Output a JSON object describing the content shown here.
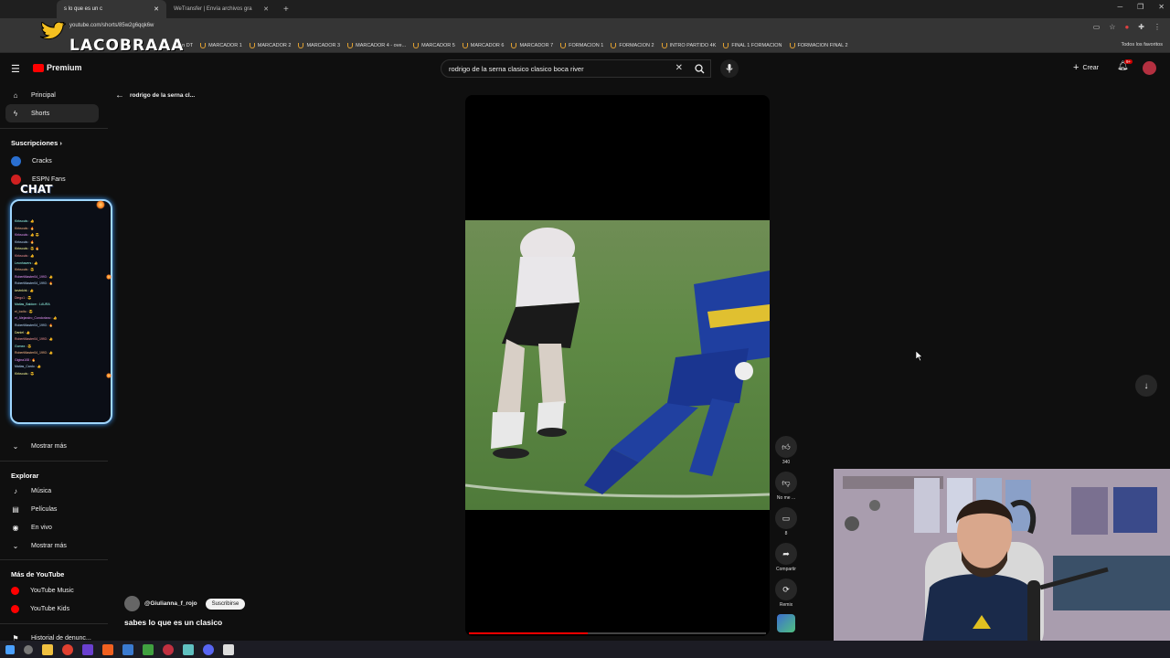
{
  "browser": {
    "tabs": [
      {
        "title": "s lo que es un c",
        "active": true
      },
      {
        "title": "WeTransfer | Envía archivos gra",
        "active": false
      }
    ],
    "url": "youtube.com/shorts/85w2g6qqk6w",
    "bookmarks": [
      "Gran DT",
      "MARCADOR 1",
      "MARCADOR 2",
      "MARCADOR 3",
      "MARCADOR 4 - ove...",
      "MARCADOR 5",
      "MARCADOR 6",
      "MARCADOR 7",
      "FORMACION 1",
      "FORMACION 2",
      "INTRO PARTIDO 4K",
      "FINAL 1 FORMACION",
      "FORMACION FINAL 2"
    ],
    "all_bookmarks": "Todos los favoritos"
  },
  "overlay": {
    "logo_text": "LACOBRAAA",
    "chat_label": "CHAT",
    "chat_lines": [
      "Kirksouls : 👍",
      "Kirksouls : 🔥",
      "Kirksouls : 👍 😎",
      "Kirksouls : 🔥",
      "Kirksouls : 😎 🔥",
      "Kirksouls : 👍",
      "Leonhavers : 👍",
      "Kirksouls : 😎",
      "RobertMaster04_1993 : 👍",
      "RobertMaster04_1993 : 🔥",
      "kevinkirk : 👍",
      "Diego1 : 😎",
      "Matias_Baldom : LAURA",
      "el_locito : 😎",
      "el_Alejandro_Condoriano : 👍",
      "RobertMaster04_1993 : 🔥",
      "Daniel : 👍",
      "RobertMaster04_1993 : 👍",
      "Gomez : 😎",
      "RobertMaster04_1993 : 👍",
      "Gigina108 : 🔥",
      "Matias_Cardo : 👍",
      "Kirksouls : 😎"
    ]
  },
  "youtube": {
    "brand": "Premium",
    "search": {
      "value": "rodrigo de la serna clasico clasico boca river"
    },
    "create_label": "Crear",
    "bell_badge": "9+",
    "back_label": "rodrigo de la serna cl...",
    "sidebar": {
      "principal": "Principal",
      "shorts": "Shorts",
      "subscriptions_head": "Suscripciones",
      "channels": [
        {
          "name": "Cracks",
          "color": "#2a6fd0"
        },
        {
          "name": "ESPN Fans",
          "color": "#d02020"
        }
      ],
      "more_1": "Mostrar más",
      "explore_head": "Explorar",
      "explore": [
        {
          "label": "Música",
          "icon": "music-icon"
        },
        {
          "label": "Películas",
          "icon": "film-icon"
        },
        {
          "label": "En vivo",
          "icon": "live-icon"
        }
      ],
      "more_2": "Mostrar más",
      "more_yt_head": "Más de YouTube",
      "more_yt": [
        {
          "label": "YouTube Music",
          "color": "#ff0000"
        },
        {
          "label": "YouTube Kids",
          "color": "#ff0000"
        }
      ],
      "history": "Historial de denunc..."
    },
    "short": {
      "channel": "@Giulianna_f_rojo",
      "subscribe": "Suscribirse",
      "title": "sabes lo que es un clasico",
      "progress": 0.4,
      "likes": "340",
      "dislike_label": "No me ...",
      "comments": "8",
      "share_label": "Compartir",
      "remix_label": "Remix"
    }
  }
}
